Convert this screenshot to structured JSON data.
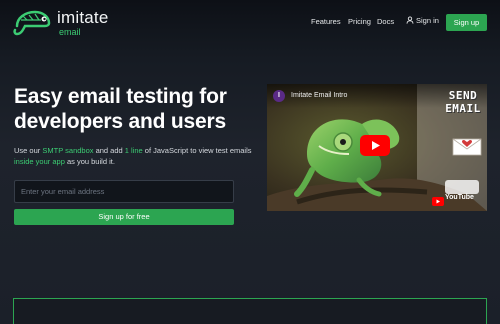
{
  "brand": {
    "name": "imitate",
    "tagline": "email",
    "logo_icon": "chameleon-icon"
  },
  "nav": {
    "links": [
      "Features",
      "Pricing",
      "Docs"
    ],
    "signin_label": "Sign in",
    "signin_icon": "user-icon",
    "signup_label": "Sign up"
  },
  "hero": {
    "headline": "Easy email testing for developers and users",
    "sub_parts": [
      "Use our ",
      "SMTP sandbox",
      " and add ",
      "1 line",
      " of JavaScript to view test emails ",
      "inside your app",
      " as you build it."
    ],
    "email_placeholder": "Enter your email address",
    "cta_label": "Sign up for free"
  },
  "video": {
    "channel_initial": "I",
    "title": "Imitate Email Intro",
    "overlay_text": "SEND EMAIL",
    "play_icon": "play-icon",
    "envelope_icon": "heart-envelope-icon",
    "watermark": "YouTube"
  },
  "colors": {
    "accent": "#2ca551",
    "accent_text": "#3ccc73",
    "bg": "#1e232c"
  }
}
